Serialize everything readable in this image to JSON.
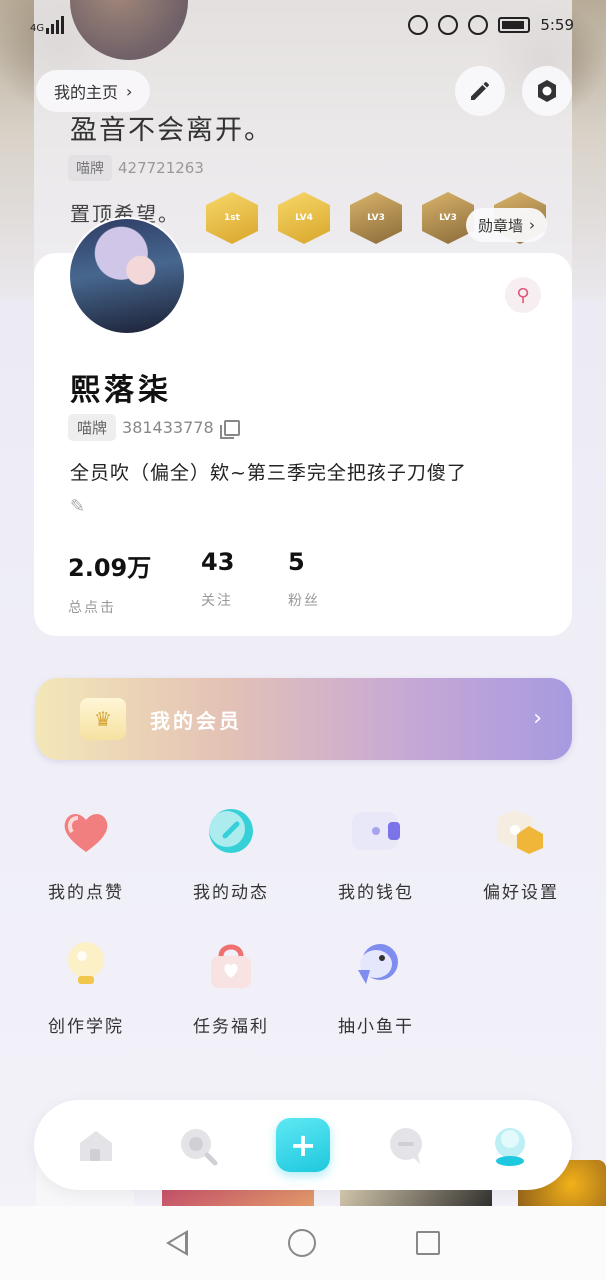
{
  "status_bar": {
    "network": "4G",
    "time": "5:59"
  },
  "background_profile": {
    "name": "盈音不会离开。",
    "tag": "喵牌",
    "id": "427721263",
    "pinned_text": "置顶希望。"
  },
  "header": {
    "my_home_label": "我的主页",
    "medal_wall_label": "勋章墙",
    "medals": [
      {
        "icon": "medal-gold-1",
        "text": "1st"
      },
      {
        "icon": "medal-gold-2",
        "text": "LV4"
      },
      {
        "icon": "medal-brown-3",
        "text": "LV3"
      },
      {
        "icon": "medal-brown-4",
        "text": "LV3"
      },
      {
        "icon": "medal-brown-5",
        "text": ""
      }
    ]
  },
  "profile": {
    "username": "熙落柒",
    "tag": "喵牌",
    "uid": "381433778",
    "bio": "全员吹（偏全）欸~第三季完全把孩子刀傻了",
    "stats": [
      {
        "value": "2.09万",
        "label": "总点击"
      },
      {
        "value": "43",
        "label": "关注"
      },
      {
        "value": "5",
        "label": "粉丝"
      }
    ]
  },
  "vip": {
    "label": "我的会员"
  },
  "menu": {
    "items": [
      {
        "label": "我的点赞",
        "icon": "heart-icon",
        "color": "#f26b6b"
      },
      {
        "label": "我的动态",
        "icon": "dynamic-icon",
        "color": "#35d0d8"
      },
      {
        "label": "我的钱包",
        "icon": "wallet-icon",
        "color": "#7b74e8"
      },
      {
        "label": "偏好设置",
        "icon": "preference-icon",
        "color": "#f0b63a"
      },
      {
        "label": "创作学院",
        "icon": "lightbulb-icon",
        "color": "#f2c64a"
      },
      {
        "label": "任务福利",
        "icon": "gift-bag-icon",
        "color": "#f07070"
      },
      {
        "label": "抽小鱼干",
        "icon": "fish-icon",
        "color": "#7f8cf0"
      }
    ]
  },
  "tabbar": {
    "items": [
      "home-tab-icon",
      "search-tab-icon",
      "create-tab-icon",
      "message-tab-icon",
      "profile-tab-icon"
    ],
    "accent": "#1ec8de"
  }
}
